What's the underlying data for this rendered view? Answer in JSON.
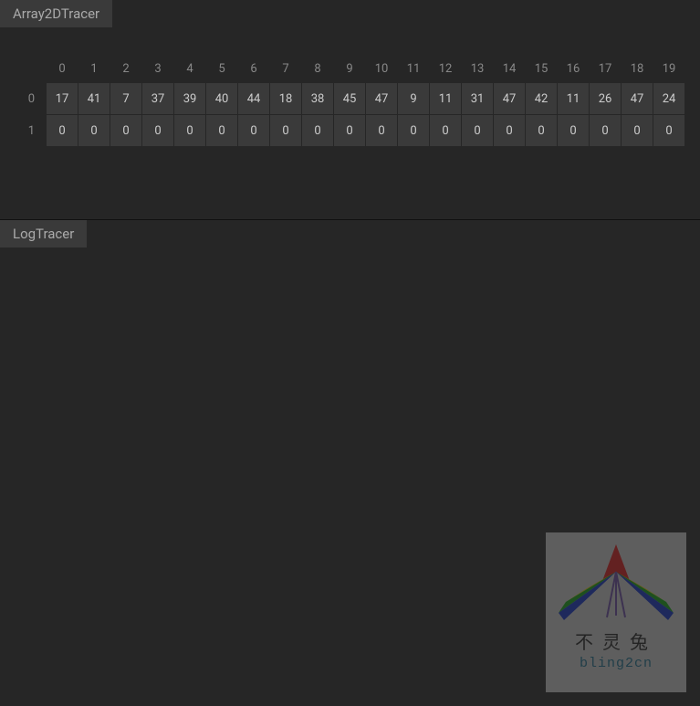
{
  "panels": {
    "array": {
      "title": "Array2DTracer"
    },
    "log": {
      "title": "LogTracer"
    }
  },
  "grid": {
    "col_headers": [
      "0",
      "1",
      "2",
      "3",
      "4",
      "5",
      "6",
      "7",
      "8",
      "9",
      "10",
      "11",
      "12",
      "13",
      "14",
      "15",
      "16",
      "17",
      "18",
      "19"
    ],
    "row_labels": [
      "0",
      "1"
    ],
    "rows": [
      [
        "17",
        "41",
        "7",
        "37",
        "39",
        "40",
        "44",
        "18",
        "38",
        "45",
        "47",
        "9",
        "11",
        "31",
        "47",
        "42",
        "11",
        "26",
        "47",
        "24"
      ],
      [
        "0",
        "0",
        "0",
        "0",
        "0",
        "0",
        "0",
        "0",
        "0",
        "0",
        "0",
        "0",
        "0",
        "0",
        "0",
        "0",
        "0",
        "0",
        "0",
        "0"
      ]
    ]
  },
  "watermark": {
    "line1": "不灵兔",
    "line2": "bling2cn"
  }
}
